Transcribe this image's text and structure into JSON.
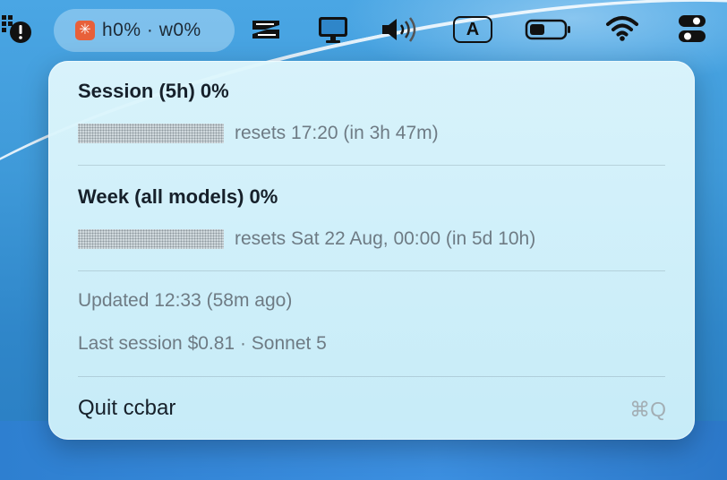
{
  "menubar": {
    "status": {
      "logo_glyph": "✳",
      "text": "h0% · w0%"
    },
    "icons": [
      "alert-apps-icon",
      "readdle-spark-icon",
      "display-icon",
      "volume-icon",
      "input-source-icon",
      "battery-icon",
      "wifi-icon",
      "control-center-icon"
    ],
    "input_source_letter": "A"
  },
  "menu": {
    "session": {
      "title": "Session (5h)  0%",
      "progress": 0,
      "reset_text": "resets 17:20 (in 3h 47m)"
    },
    "week": {
      "title": "Week (all models)  0%",
      "progress": 0,
      "reset_text": "resets Sat 22 Aug, 00:00 (in 5d 10h)"
    },
    "updated": "Updated 12:33 (58m ago)",
    "last_session": "Last session $0.81 · Sonnet 5",
    "quit_label": "Quit ccbar",
    "quit_shortcut": "⌘Q"
  },
  "colors": {
    "accent": "#3c6fb8",
    "menu_bg": "#d6f3fb",
    "logo": "#e8603a"
  }
}
